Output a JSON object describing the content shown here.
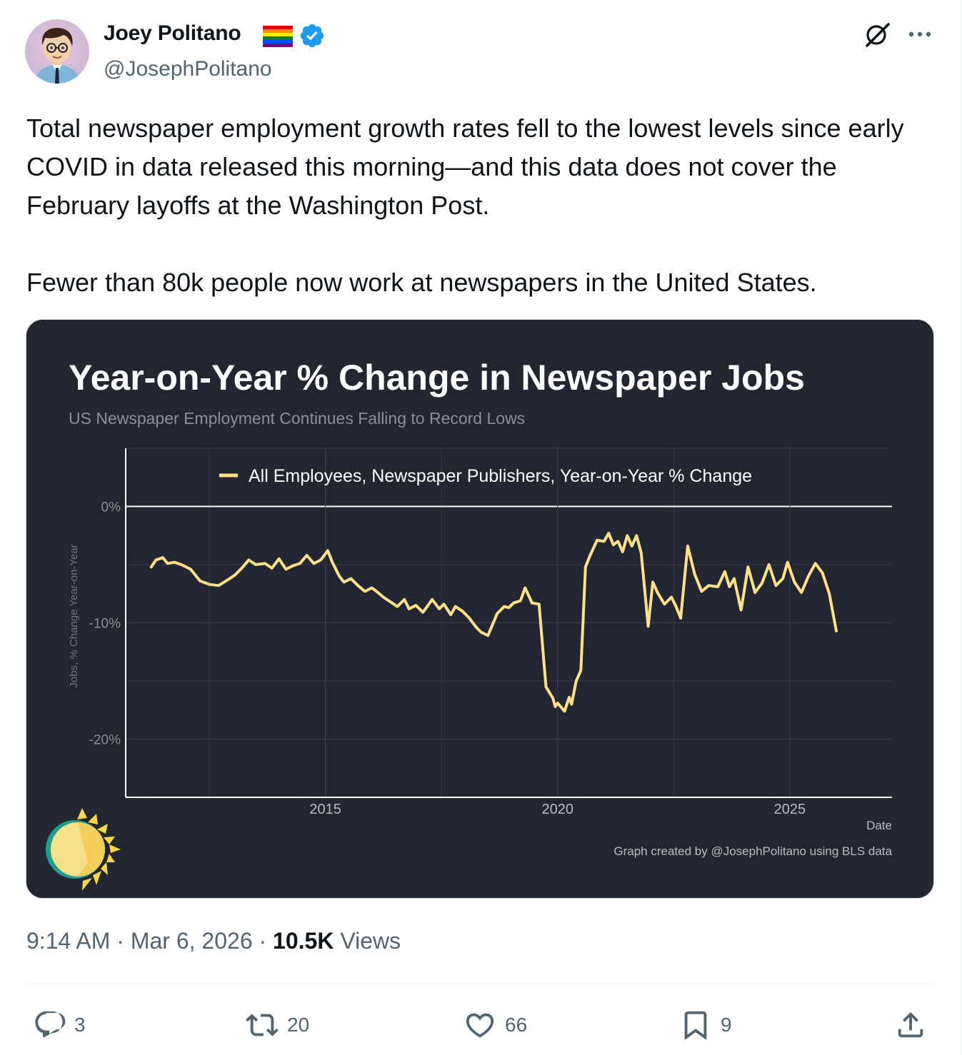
{
  "author": {
    "name": "Joey Politano",
    "handle": "@JosephPolitano"
  },
  "icons": {
    "flag": "rainbow-flag-icon",
    "verified": "verified-badge-icon",
    "grok": "grok-icon",
    "more": "more-icon",
    "reply": "reply-icon",
    "retweet": "retweet-icon",
    "like": "heart-icon",
    "bookmark": "bookmark-icon",
    "share": "share-icon"
  },
  "colors": {
    "chart_bg": "#222630",
    "line": "#ffe089",
    "verified": "#1d9bf0",
    "muted": "#536471"
  },
  "tweet": {
    "paragraph1": "Total newspaper employment growth rates fell to the lowest levels since early COVID in data released this morning—and this data does not cover the February layoffs at the Washington Post.",
    "paragraph2": "Fewer than 80k people now work at newspapers in the United States."
  },
  "meta": {
    "time": "9:14 AM",
    "separator": " · ",
    "date": "Mar 6, 2026",
    "views_count": "10.5K",
    "views_label": "Views"
  },
  "actions": {
    "replies": "3",
    "retweets": "20",
    "likes": "66",
    "bookmarks": "9"
  },
  "chart_data": {
    "type": "line",
    "title": "Year-on-Year % Change in Newspaper Jobs",
    "subtitle": "US Newspaper Employment Continues Falling to Record Lows",
    "xlabel": "Date",
    "ylabel": "Jobs, % Change Year-on-Year",
    "xlim": [
      2010.7,
      2027.2
    ],
    "ylim": [
      -25,
      5
    ],
    "x_ticks": [
      2015,
      2020,
      2025
    ],
    "x_tick_labels": [
      "2015",
      "2020",
      "2025"
    ],
    "y_ticks": [
      0,
      -10,
      -20
    ],
    "y_tick_labels": [
      "0%",
      "-10%",
      "-20%"
    ],
    "grid": true,
    "legend": "top-center",
    "caption": "Graph created by @JosephPolitano using BLS data",
    "series": [
      {
        "name": "All Employees, Newspaper Publishers, Year-on-Year % Change",
        "x": [
          2011.25,
          2011.35,
          2011.5,
          2011.6,
          2011.75,
          2011.9,
          2012.1,
          2012.3,
          2012.5,
          2012.7,
          2012.9,
          2013.05,
          2013.2,
          2013.35,
          2013.5,
          2013.7,
          2013.85,
          2014.0,
          2014.15,
          2014.3,
          2014.45,
          2014.6,
          2014.75,
          2014.9,
          2015.05,
          2015.15,
          2015.3,
          2015.4,
          2015.55,
          2015.7,
          2015.85,
          2016.0,
          2016.1,
          2016.25,
          2016.4,
          2016.55,
          2016.7,
          2016.8,
          2016.95,
          2017.1,
          2017.3,
          2017.45,
          2017.55,
          2017.7,
          2017.8,
          2017.95,
          2018.1,
          2018.25,
          2018.35,
          2018.5,
          2018.7,
          2018.85,
          2018.95,
          2019.05,
          2019.2,
          2019.3,
          2019.45,
          2019.6,
          2019.75,
          2019.9,
          2019.95,
          2020.0,
          2020.15,
          2020.25,
          2020.3,
          2020.4,
          2020.5,
          2020.6,
          2020.7,
          2020.85,
          2021.0,
          2021.1,
          2021.2,
          2021.3,
          2021.4,
          2021.5,
          2021.6,
          2021.7,
          2021.8,
          2021.95,
          2022.05,
          2022.15,
          2022.3,
          2022.45,
          2022.55,
          2022.65,
          2022.8,
          2022.95,
          2023.1,
          2023.25,
          2023.45,
          2023.6,
          2023.7,
          2023.8,
          2023.95,
          2024.1,
          2024.25,
          2024.4,
          2024.55,
          2024.7,
          2024.85,
          2024.95,
          2025.1,
          2025.25,
          2025.4,
          2025.55,
          2025.7,
          2025.85,
          2026.0
        ],
        "y": [
          -5.2,
          -4.6,
          -4.4,
          -4.9,
          -4.8,
          -5.0,
          -5.4,
          -6.4,
          -6.7,
          -6.8,
          -6.3,
          -5.9,
          -5.3,
          -4.6,
          -5.0,
          -4.9,
          -5.3,
          -4.5,
          -5.4,
          -5.1,
          -4.9,
          -4.2,
          -4.9,
          -4.6,
          -3.8,
          -4.8,
          -6.0,
          -6.5,
          -6.2,
          -6.8,
          -7.3,
          -7.0,
          -7.3,
          -7.8,
          -8.2,
          -8.6,
          -8.0,
          -8.8,
          -8.5,
          -9.1,
          -8.0,
          -8.8,
          -8.4,
          -9.3,
          -8.6,
          -9.0,
          -9.6,
          -10.4,
          -10.8,
          -11.1,
          -9.2,
          -8.6,
          -8.7,
          -8.3,
          -8.1,
          -7.0,
          -8.3,
          -8.4,
          -15.5,
          -16.5,
          -17.2,
          -16.9,
          -17.6,
          -16.4,
          -17.0,
          -15.0,
          -14.1,
          -5.2,
          -4.2,
          -2.9,
          -3.0,
          -2.3,
          -3.3,
          -3.0,
          -3.9,
          -2.5,
          -3.4,
          -2.5,
          -4.0,
          -10.3,
          -6.5,
          -7.4,
          -8.4,
          -7.8,
          -8.6,
          -9.6,
          -3.4,
          -5.8,
          -7.3,
          -6.8,
          -6.9,
          -5.6,
          -6.9,
          -6.2,
          -8.9,
          -5.2,
          -7.4,
          -6.6,
          -5.0,
          -6.8,
          -6.2,
          -4.8,
          -6.5,
          -7.4,
          -6.0,
          -4.9,
          -5.7,
          -7.5,
          -10.7
        ]
      }
    ]
  }
}
